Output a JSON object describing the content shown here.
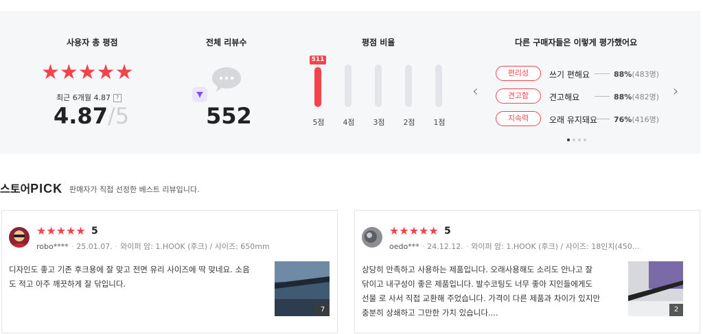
{
  "summary": {
    "avg_title": "사용자 총 평점",
    "avg_stars": "★★★★★",
    "recent_label": "최근 6개월 4.87",
    "help_mark": "?",
    "score": "4.87",
    "score_max": "/5",
    "count_title": "전체 리뷰수",
    "review_count": "552",
    "ratio_title": "평점 비율",
    "rating_bars": [
      {
        "label": "5점",
        "count": "511",
        "fraction": 0.93
      },
      {
        "label": "4점",
        "fraction": 0.0
      },
      {
        "label": "3점",
        "fraction": 0.0
      },
      {
        "label": "2점",
        "fraction": 0.0
      },
      {
        "label": "1점",
        "fraction": 0.0
      }
    ],
    "eval_title": "다른 구매자들은 이렇게 평가했어요",
    "evaluations": [
      {
        "tag": "편리성",
        "text": "쓰기 편해요",
        "pct": "88%",
        "count": "(483명)"
      },
      {
        "tag": "견고함",
        "text": "견고해요",
        "pct": "88%",
        "count": "(482명)"
      },
      {
        "tag": "지속력",
        "text": "오래 유지돼요",
        "pct": "76%",
        "count": "(416명)"
      }
    ],
    "prev_arrow": "‹",
    "next_arrow": "›"
  },
  "pick": {
    "title_prefix": "스토어",
    "title_pick": "PICK",
    "subtitle": "판매자가 직접 선정한 베스트 리뷰입니다."
  },
  "reviews": [
    {
      "stars": "★★★★★",
      "score": "5",
      "user": "robo****",
      "date": "25.01.07.",
      "option": "와이퍼 암: 1.HOOK (후크) / 사이즈: 650mm",
      "body": "디자인도 좋고 기존 후크용에 잘 맞고 전면 유리 사이즈에 딱 맞네요. 소음도 적고 아주 깨끗하게 잘 닦입니다.",
      "photo_count": "7"
    },
    {
      "stars": "★★★★★",
      "score": "5",
      "user": "oedo***",
      "date": "24.12.12.",
      "option": "와이퍼 암: 1.HOOK (후크) / 사이즈: 18인치(450...",
      "body": "상당히 만족하고 사용하는 제품입니다. 오래사용해도 소리도 안나고 잘 닦이고 내구성이 좋은 제품입니다. 발수코팅도 너무 좋아 지인들에게도 선물 로 사서 직접 교환해 주었습니다. 가격이 다른 제품과 차이가 있지만 충분히 상쇄하고 그만한 가치 있습니다....",
      "photo_count": "2"
    }
  ],
  "colors": {
    "accent": "#f5434b",
    "panel_bg": "#f6f7f8"
  }
}
